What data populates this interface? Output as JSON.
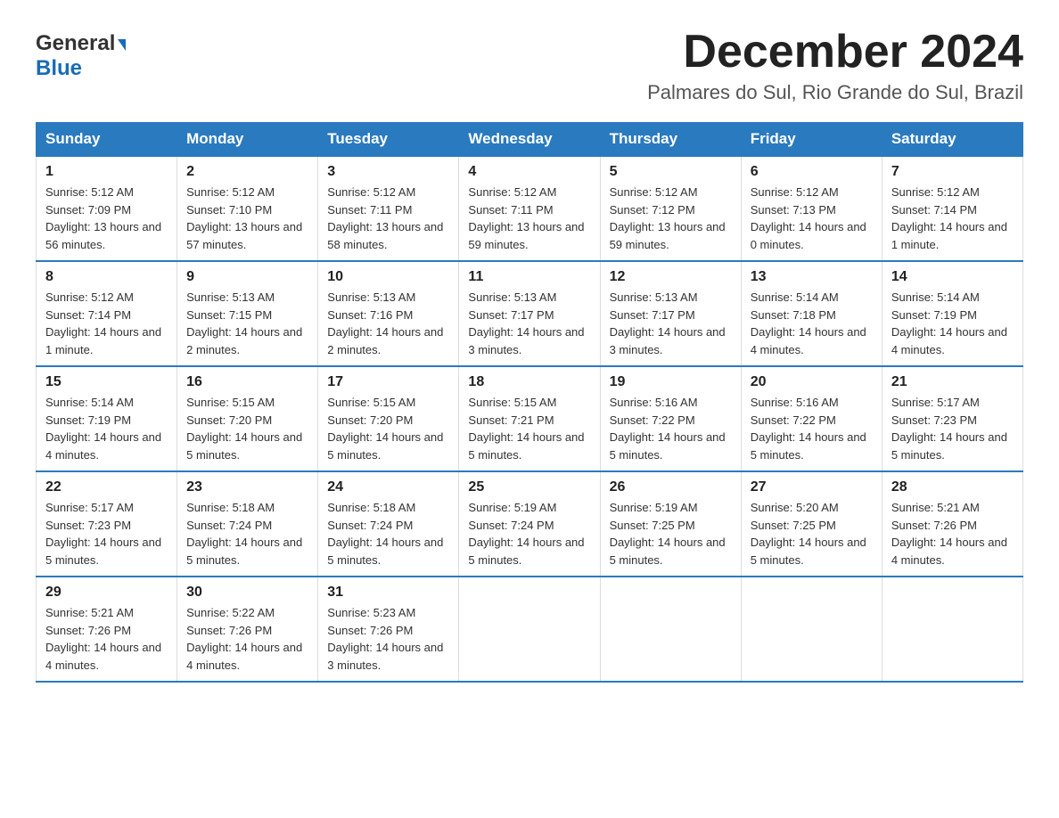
{
  "logo": {
    "line1": "General",
    "arrow": "▶",
    "line2": "Blue"
  },
  "title": "December 2024",
  "subtitle": "Palmares do Sul, Rio Grande do Sul, Brazil",
  "days_of_week": [
    "Sunday",
    "Monday",
    "Tuesday",
    "Wednesday",
    "Thursday",
    "Friday",
    "Saturday"
  ],
  "weeks": [
    [
      {
        "day": "1",
        "sunrise": "5:12 AM",
        "sunset": "7:09 PM",
        "daylight": "13 hours and 56 minutes."
      },
      {
        "day": "2",
        "sunrise": "5:12 AM",
        "sunset": "7:10 PM",
        "daylight": "13 hours and 57 minutes."
      },
      {
        "day": "3",
        "sunrise": "5:12 AM",
        "sunset": "7:11 PM",
        "daylight": "13 hours and 58 minutes."
      },
      {
        "day": "4",
        "sunrise": "5:12 AM",
        "sunset": "7:11 PM",
        "daylight": "13 hours and 59 minutes."
      },
      {
        "day": "5",
        "sunrise": "5:12 AM",
        "sunset": "7:12 PM",
        "daylight": "13 hours and 59 minutes."
      },
      {
        "day": "6",
        "sunrise": "5:12 AM",
        "sunset": "7:13 PM",
        "daylight": "14 hours and 0 minutes."
      },
      {
        "day": "7",
        "sunrise": "5:12 AM",
        "sunset": "7:14 PM",
        "daylight": "14 hours and 1 minute."
      }
    ],
    [
      {
        "day": "8",
        "sunrise": "5:12 AM",
        "sunset": "7:14 PM",
        "daylight": "14 hours and 1 minute."
      },
      {
        "day": "9",
        "sunrise": "5:13 AM",
        "sunset": "7:15 PM",
        "daylight": "14 hours and 2 minutes."
      },
      {
        "day": "10",
        "sunrise": "5:13 AM",
        "sunset": "7:16 PM",
        "daylight": "14 hours and 2 minutes."
      },
      {
        "day": "11",
        "sunrise": "5:13 AM",
        "sunset": "7:17 PM",
        "daylight": "14 hours and 3 minutes."
      },
      {
        "day": "12",
        "sunrise": "5:13 AM",
        "sunset": "7:17 PM",
        "daylight": "14 hours and 3 minutes."
      },
      {
        "day": "13",
        "sunrise": "5:14 AM",
        "sunset": "7:18 PM",
        "daylight": "14 hours and 4 minutes."
      },
      {
        "day": "14",
        "sunrise": "5:14 AM",
        "sunset": "7:19 PM",
        "daylight": "14 hours and 4 minutes."
      }
    ],
    [
      {
        "day": "15",
        "sunrise": "5:14 AM",
        "sunset": "7:19 PM",
        "daylight": "14 hours and 4 minutes."
      },
      {
        "day": "16",
        "sunrise": "5:15 AM",
        "sunset": "7:20 PM",
        "daylight": "14 hours and 5 minutes."
      },
      {
        "day": "17",
        "sunrise": "5:15 AM",
        "sunset": "7:20 PM",
        "daylight": "14 hours and 5 minutes."
      },
      {
        "day": "18",
        "sunrise": "5:15 AM",
        "sunset": "7:21 PM",
        "daylight": "14 hours and 5 minutes."
      },
      {
        "day": "19",
        "sunrise": "5:16 AM",
        "sunset": "7:22 PM",
        "daylight": "14 hours and 5 minutes."
      },
      {
        "day": "20",
        "sunrise": "5:16 AM",
        "sunset": "7:22 PM",
        "daylight": "14 hours and 5 minutes."
      },
      {
        "day": "21",
        "sunrise": "5:17 AM",
        "sunset": "7:23 PM",
        "daylight": "14 hours and 5 minutes."
      }
    ],
    [
      {
        "day": "22",
        "sunrise": "5:17 AM",
        "sunset": "7:23 PM",
        "daylight": "14 hours and 5 minutes."
      },
      {
        "day": "23",
        "sunrise": "5:18 AM",
        "sunset": "7:24 PM",
        "daylight": "14 hours and 5 minutes."
      },
      {
        "day": "24",
        "sunrise": "5:18 AM",
        "sunset": "7:24 PM",
        "daylight": "14 hours and 5 minutes."
      },
      {
        "day": "25",
        "sunrise": "5:19 AM",
        "sunset": "7:24 PM",
        "daylight": "14 hours and 5 minutes."
      },
      {
        "day": "26",
        "sunrise": "5:19 AM",
        "sunset": "7:25 PM",
        "daylight": "14 hours and 5 minutes."
      },
      {
        "day": "27",
        "sunrise": "5:20 AM",
        "sunset": "7:25 PM",
        "daylight": "14 hours and 5 minutes."
      },
      {
        "day": "28",
        "sunrise": "5:21 AM",
        "sunset": "7:26 PM",
        "daylight": "14 hours and 4 minutes."
      }
    ],
    [
      {
        "day": "29",
        "sunrise": "5:21 AM",
        "sunset": "7:26 PM",
        "daylight": "14 hours and 4 minutes."
      },
      {
        "day": "30",
        "sunrise": "5:22 AM",
        "sunset": "7:26 PM",
        "daylight": "14 hours and 4 minutes."
      },
      {
        "day": "31",
        "sunrise": "5:23 AM",
        "sunset": "7:26 PM",
        "daylight": "14 hours and 3 minutes."
      },
      null,
      null,
      null,
      null
    ]
  ],
  "sunrise_label": "Sunrise:",
  "sunset_label": "Sunset:",
  "daylight_label": "Daylight:"
}
